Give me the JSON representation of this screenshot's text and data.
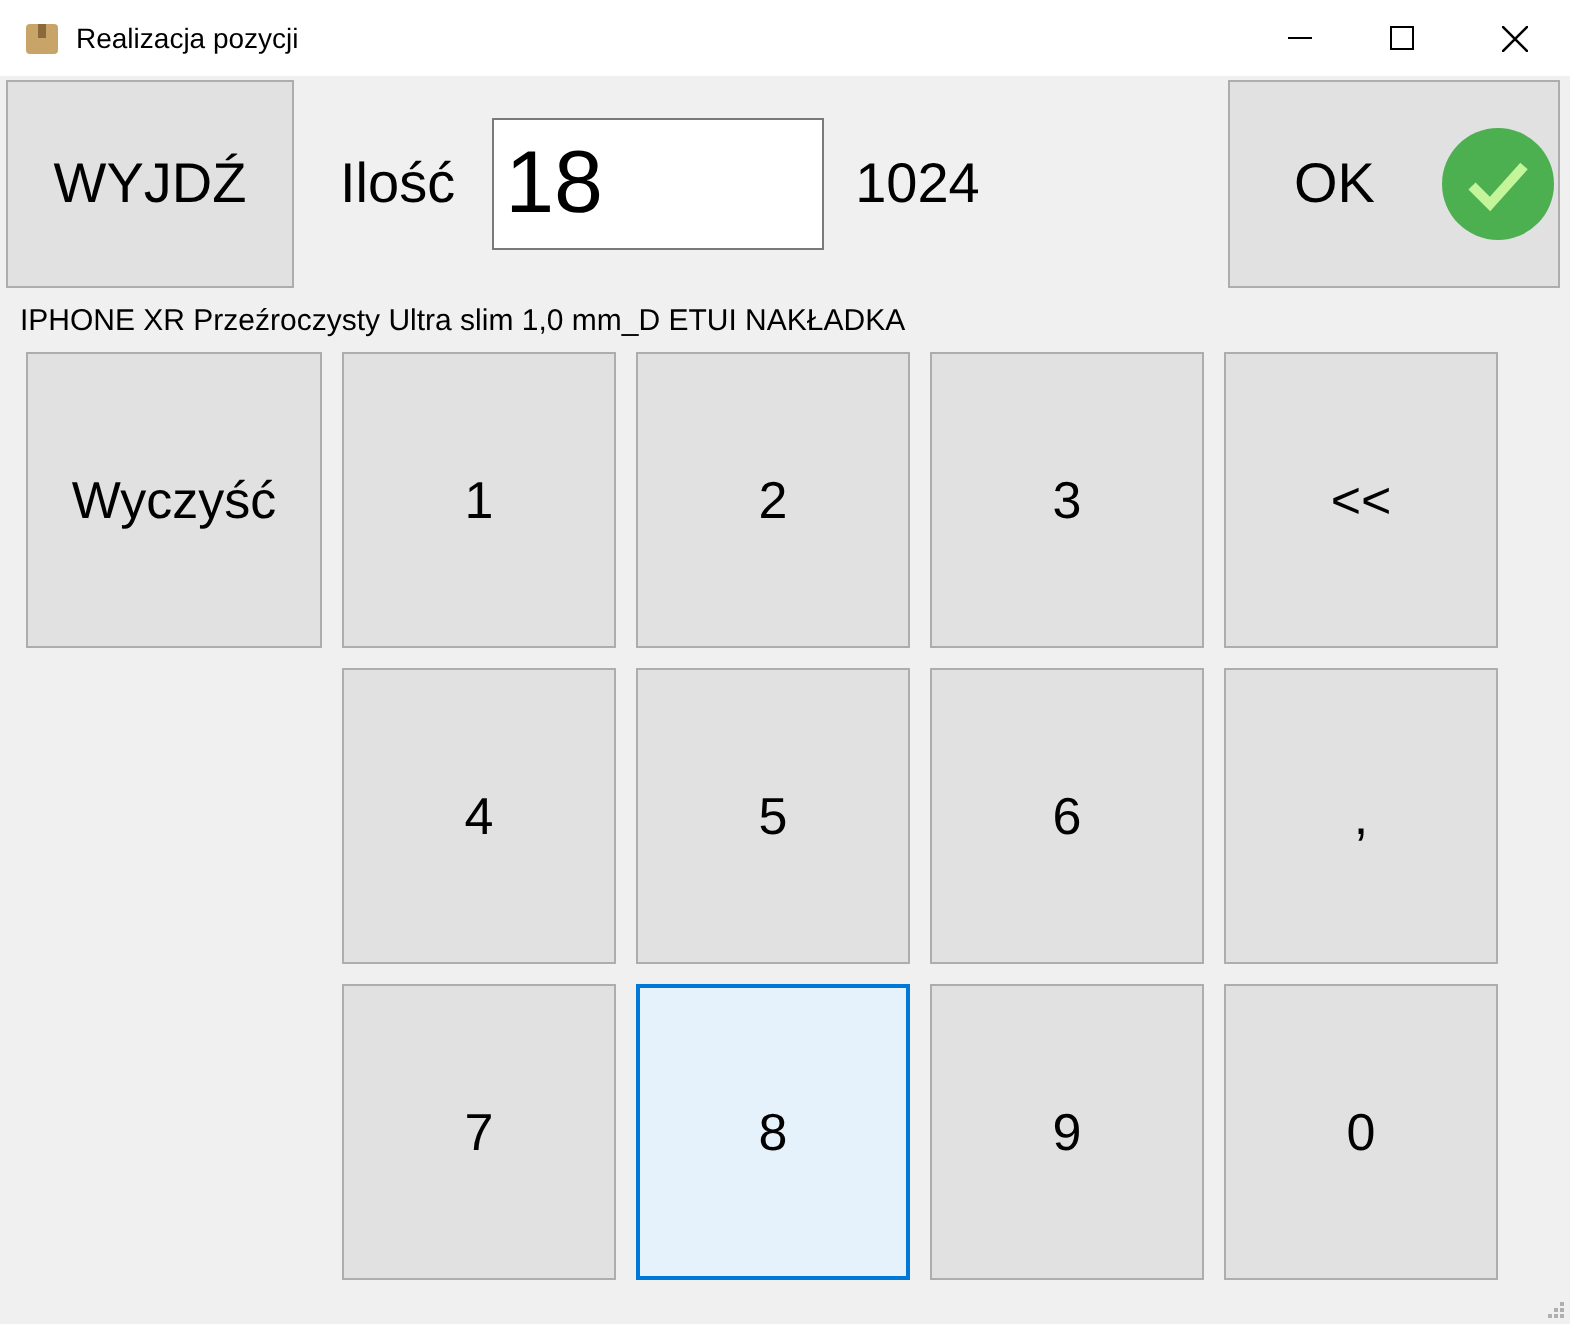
{
  "window": {
    "title": "Realizacja pozycji"
  },
  "exit_button": {
    "label": "WYJDŹ"
  },
  "quantity": {
    "label": "Ilość",
    "value": "18"
  },
  "stock": "1024",
  "ok_button": {
    "label": "OK"
  },
  "product_name": "IPHONE XR Przeźroczysty Ultra slim 1,0 mm_D ETUI NAKŁADKA",
  "clear_button": {
    "label": "Wyczyść"
  },
  "keypad_rows": [
    [
      {
        "label": "1",
        "focused": false
      },
      {
        "label": "2",
        "focused": false
      },
      {
        "label": "3",
        "focused": false
      },
      {
        "label": "<<",
        "focused": false
      }
    ],
    [
      {
        "label": "4",
        "focused": false
      },
      {
        "label": "5",
        "focused": false
      },
      {
        "label": "6",
        "focused": false
      },
      {
        "label": ",",
        "focused": false
      }
    ],
    [
      {
        "label": "7",
        "focused": false
      },
      {
        "label": "8",
        "focused": true
      },
      {
        "label": "9",
        "focused": false
      },
      {
        "label": "0",
        "focused": false
      }
    ]
  ]
}
